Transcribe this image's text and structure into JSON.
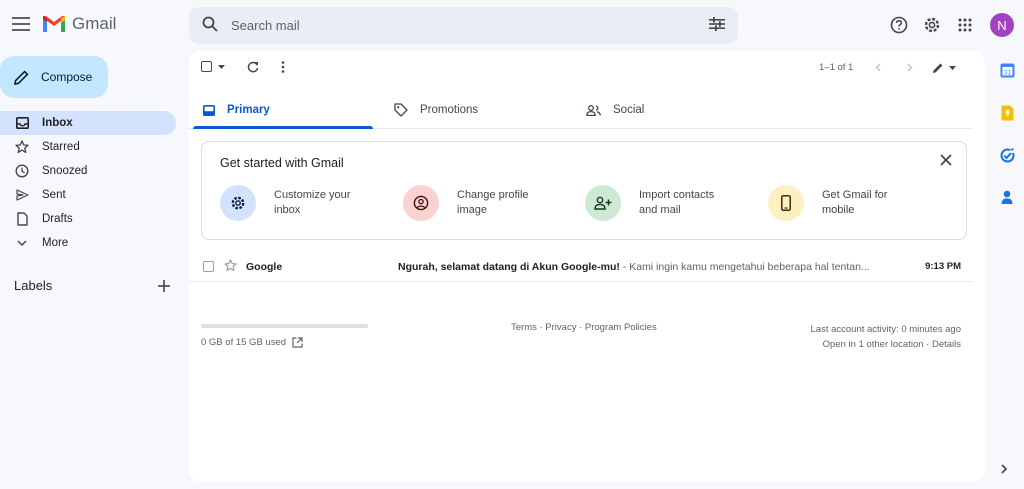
{
  "app": {
    "name": "Gmail"
  },
  "search": {
    "placeholder": "Search mail"
  },
  "account": {
    "avatar_letter": "N",
    "avatar_color": "#a142c4"
  },
  "compose": {
    "label": "Compose"
  },
  "sidebar": {
    "items": [
      {
        "label": "Inbox",
        "icon": "inbox-icon",
        "active": true
      },
      {
        "label": "Starred",
        "icon": "star-icon"
      },
      {
        "label": "Snoozed",
        "icon": "clock-icon"
      },
      {
        "label": "Sent",
        "icon": "send-icon"
      },
      {
        "label": "Drafts",
        "icon": "draft-icon"
      },
      {
        "label": "More",
        "icon": "chevron-down-icon"
      }
    ],
    "labels_heading": "Labels"
  },
  "toolbar": {
    "pager": "1–1 of 1"
  },
  "tabs": [
    {
      "label": "Primary",
      "icon": "inbox-icon",
      "active": true
    },
    {
      "label": "Promotions",
      "icon": "tag-icon"
    },
    {
      "label": "Social",
      "icon": "people-icon"
    }
  ],
  "get_started": {
    "title": "Get started with Gmail",
    "features": [
      {
        "label": "Customize your inbox",
        "icon": "gear-icon",
        "color": "#d3e3fd"
      },
      {
        "label": "Change profile image",
        "icon": "account-circle-icon",
        "color": "#fad2cf"
      },
      {
        "label": "Import contacts and mail",
        "icon": "person-add-icon",
        "color": "#ceead6"
      },
      {
        "label": "Get Gmail for mobile",
        "icon": "phone-icon",
        "color": "#feefc3"
      }
    ]
  },
  "emails": [
    {
      "sender": "Google",
      "subject": "Ngurah, selamat datang di Akun Google-mu!",
      "snippet": " - Kami ingin kamu mengetahui beberapa hal tentan...",
      "time": "9:13 PM"
    }
  ],
  "footer": {
    "storage_used": "0 GB of 15 GB used",
    "storage_fraction": 0.0,
    "policies": "Terms · Privacy · Program Policies",
    "last_activity": "Last account activity: 0 minutes ago",
    "location": "Open in 1 other location · Details"
  },
  "colors": {
    "accent": "#0b57d0",
    "compose_bg": "#c2e7ff",
    "active_nav": "#d3e3fd"
  }
}
